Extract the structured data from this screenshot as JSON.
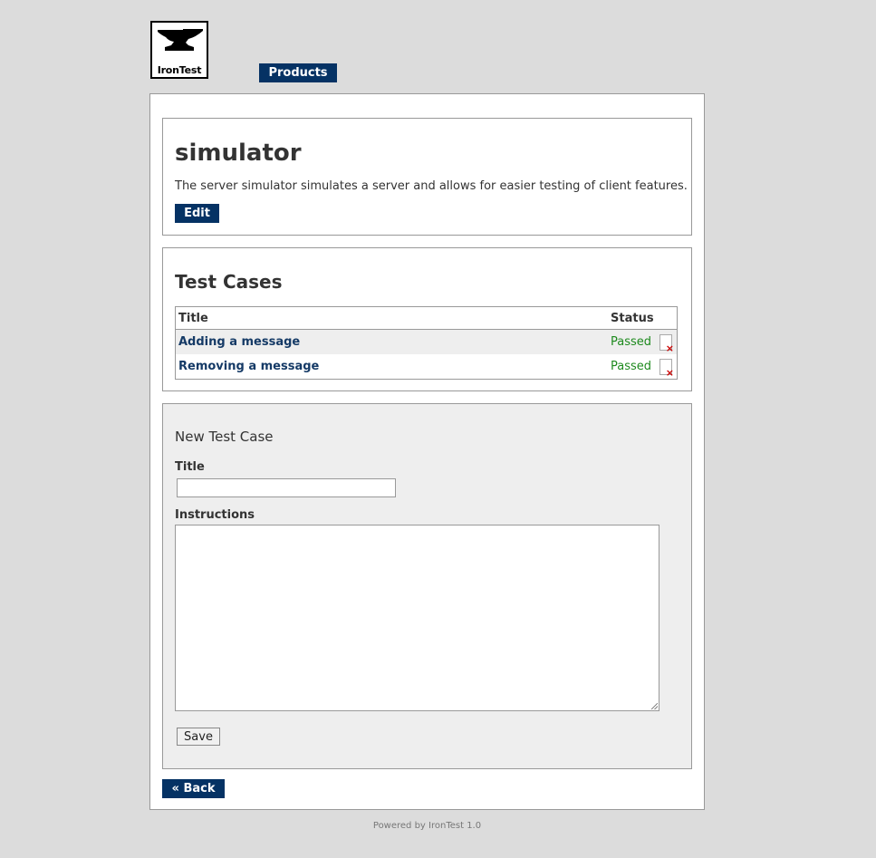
{
  "header": {
    "logo_text": "IronTest",
    "nav_products": "Products"
  },
  "product": {
    "name": "simulator",
    "description": "The server simulator simulates a server and allows for easier testing of client features.",
    "edit_label": "Edit"
  },
  "test_cases": {
    "heading": "Test Cases",
    "columns": [
      "Title",
      "Status"
    ],
    "rows": [
      {
        "title": "Adding a message",
        "status": "Passed"
      },
      {
        "title": "Removing a message",
        "status": "Passed"
      }
    ]
  },
  "new_test_case": {
    "heading": "New Test Case",
    "title_label": "Title",
    "title_value": "",
    "instructions_label": "Instructions",
    "instructions_value": "",
    "save_label": "Save"
  },
  "back_label": "« Back",
  "footer": "Powered by IronTest 1.0",
  "colors": {
    "background": "#dcdcdc",
    "nav_button": "#053264",
    "link": "#153a66",
    "status_passed": "#1e8a1e",
    "delete_icon": "#cc0000"
  },
  "icons": {
    "logo": "anvil-icon",
    "delete": "delete-icon"
  }
}
